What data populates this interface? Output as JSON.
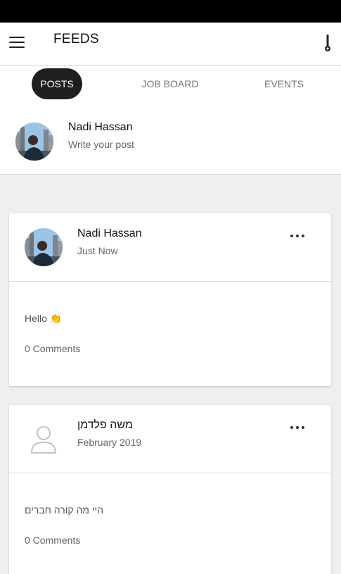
{
  "appbar": {
    "title": "FEEDS",
    "menu_icon": "hamburger-menu-icon",
    "action_icon": "thermometer-icon"
  },
  "tabs": [
    {
      "label": "POSTS",
      "active": true
    },
    {
      "label": "JOB BOARD",
      "active": false
    },
    {
      "label": "EVENTS",
      "active": false
    }
  ],
  "compose": {
    "name": "Nadi Hassan",
    "prompt": "Write your post"
  },
  "posts": [
    {
      "author": "Nadi Hassan",
      "time": "Just Now",
      "text": "Hello 👏",
      "comments": "0 Comments"
    },
    {
      "author": "משה פלדמן",
      "time": "February 2019",
      "text": "היי מה קורה חברים",
      "comments": "0 Comments"
    }
  ],
  "colors": {
    "status_bar": "#000000",
    "active_tab": "#1f1f1f",
    "background": "#efefef"
  }
}
